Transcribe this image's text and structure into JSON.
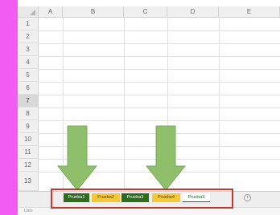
{
  "columns": [
    "A",
    "B",
    "C",
    "D",
    "E"
  ],
  "rows": [
    "1",
    "2",
    "3",
    "4",
    "5",
    "6",
    "7",
    "8",
    "9",
    "10",
    "11",
    "12",
    "13"
  ],
  "sheet_tabs": [
    {
      "label": "Prueba1",
      "style": "green"
    },
    {
      "label": "Prueba2",
      "style": "yellow"
    },
    {
      "label": "Prueba3",
      "style": "green"
    },
    {
      "label": "Prueba4",
      "style": "yellow"
    },
    {
      "label": "Prueba5",
      "style": "active"
    }
  ],
  "add_tab_label": "+",
  "status_text": "Listo",
  "colors": {
    "background": "#f35cf0",
    "tab_green": "#2e6b1f",
    "tab_yellow": "#f6c838",
    "arrow": "#8fbf6a",
    "frame": "#c0392b"
  },
  "icons": [
    "down-arrow-icon",
    "add-sheet-icon"
  ]
}
